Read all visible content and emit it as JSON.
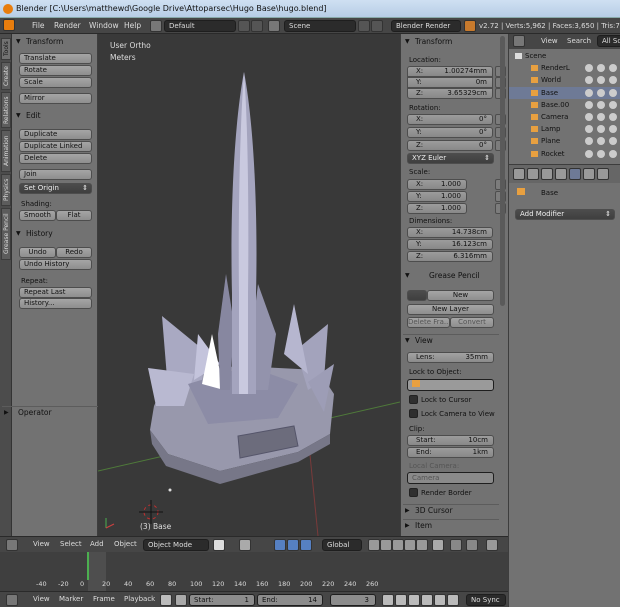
{
  "window": {
    "title": "Blender [C:\\Users\\matthewd\\Google Drive\\Attoparsec\\Hugo Base\\hugo.blend]"
  },
  "info_header": {
    "menus": [
      "File",
      "Render",
      "Window",
      "Help"
    ],
    "layout": "Default",
    "scene": "Scene",
    "engine": "Blender Render",
    "stats": "v2.72 | Verts:5,962 | Faces:3,650 | Tris:7,"
  },
  "tool_tabs": [
    "Tools",
    "Create",
    "Relations",
    "Animation",
    "Physics",
    "Grease Pencil"
  ],
  "toolshelf": {
    "transform": {
      "title": "Transform",
      "buttons": [
        "Translate",
        "Rotate",
        "Scale",
        "Mirror"
      ]
    },
    "edit": {
      "title": "Edit",
      "buttons": [
        "Duplicate",
        "Duplicate Linked",
        "Delete",
        "Join"
      ],
      "set_origin": "Set Origin",
      "shading_label": "Shading:",
      "smooth": "Smooth",
      "flat": "Flat"
    },
    "history": {
      "title": "History",
      "undo": "Undo",
      "redo": "Redo",
      "undo_history": "Undo History",
      "repeat_label": "Repeat:",
      "repeat_last": "Repeat Last",
      "history_btn": "History..."
    },
    "operator": "Operator"
  },
  "viewport": {
    "view_name": "User Ortho",
    "units": "Meters",
    "object_label": "(3) Base"
  },
  "properties": {
    "transform_title": "Transform",
    "location_label": "Location:",
    "location": [
      {
        "k": "X:",
        "v": "1.00274mm"
      },
      {
        "k": "Y:",
        "v": "0m"
      },
      {
        "k": "Z:",
        "v": "3.65329cm"
      }
    ],
    "rotation_label": "Rotation:",
    "rotation": [
      {
        "k": "X:",
        "v": "0°"
      },
      {
        "k": "Y:",
        "v": "0°"
      },
      {
        "k": "Z:",
        "v": "0°"
      }
    ],
    "rotation_mode": "XYZ Euler",
    "scale_label": "Scale:",
    "scale": [
      {
        "k": "X:",
        "v": "1.000"
      },
      {
        "k": "Y:",
        "v": "1.000"
      },
      {
        "k": "Z:",
        "v": "1.000"
      }
    ],
    "dimensions_label": "Dimensions:",
    "dimensions": [
      {
        "k": "X:",
        "v": "14.738cm"
      },
      {
        "k": "Y:",
        "v": "16.123cm"
      },
      {
        "k": "Z:",
        "v": "6.316mm"
      }
    ],
    "grease_title": "Grease Pencil",
    "grease_new": "New",
    "grease_new_layer": "New Layer",
    "grease_delete": "Delete Fra...",
    "grease_convert": "Convert",
    "view_title": "View",
    "lens_label": "Lens:",
    "lens_value": "35mm",
    "lock_object_label": "Lock to Object:",
    "lock_cursor": "Lock to Cursor",
    "lock_camera": "Lock Camera to View",
    "clip_label": "Clip:",
    "clip_start_label": "Start:",
    "clip_start": "10cm",
    "clip_end_label": "End:",
    "clip_end": "1km",
    "local_camera_label": "Local Camera:",
    "local_camera": "Camera",
    "render_border": "Render Border",
    "cursor_title": "3D Cursor",
    "item_title": "Item"
  },
  "outliner": {
    "tabs": [
      "View",
      "Search",
      "All Sc"
    ],
    "items": [
      {
        "name": "Scene",
        "indent": 0
      },
      {
        "name": "RenderL",
        "indent": 1
      },
      {
        "name": "World",
        "indent": 1
      },
      {
        "name": "Base",
        "indent": 1,
        "selected": true
      },
      {
        "name": "Base.00",
        "indent": 1
      },
      {
        "name": "Camera",
        "indent": 1
      },
      {
        "name": "Lamp",
        "indent": 1
      },
      {
        "name": "Plane",
        "indent": 1
      },
      {
        "name": "Rocket",
        "indent": 1
      }
    ]
  },
  "modifiers": {
    "object_name": "Base",
    "add_modifier": "Add Modifier"
  },
  "view3d_header": {
    "menus": [
      "View",
      "Select",
      "Add",
      "Object"
    ],
    "mode": "Object Mode",
    "orientation": "Global"
  },
  "timeline": {
    "ticks": [
      "-40",
      "-20",
      "0",
      "20",
      "40",
      "60",
      "80",
      "100",
      "120",
      "140",
      "160",
      "180",
      "200",
      "220",
      "240",
      "260"
    ],
    "current_frame": 1
  },
  "timeline_header": {
    "menus": [
      "View",
      "Marker",
      "Frame",
      "Playback"
    ],
    "start_label": "Start:",
    "start": "1",
    "end_label": "End:",
    "end": "14",
    "current": "3",
    "sync": "No Sync"
  }
}
